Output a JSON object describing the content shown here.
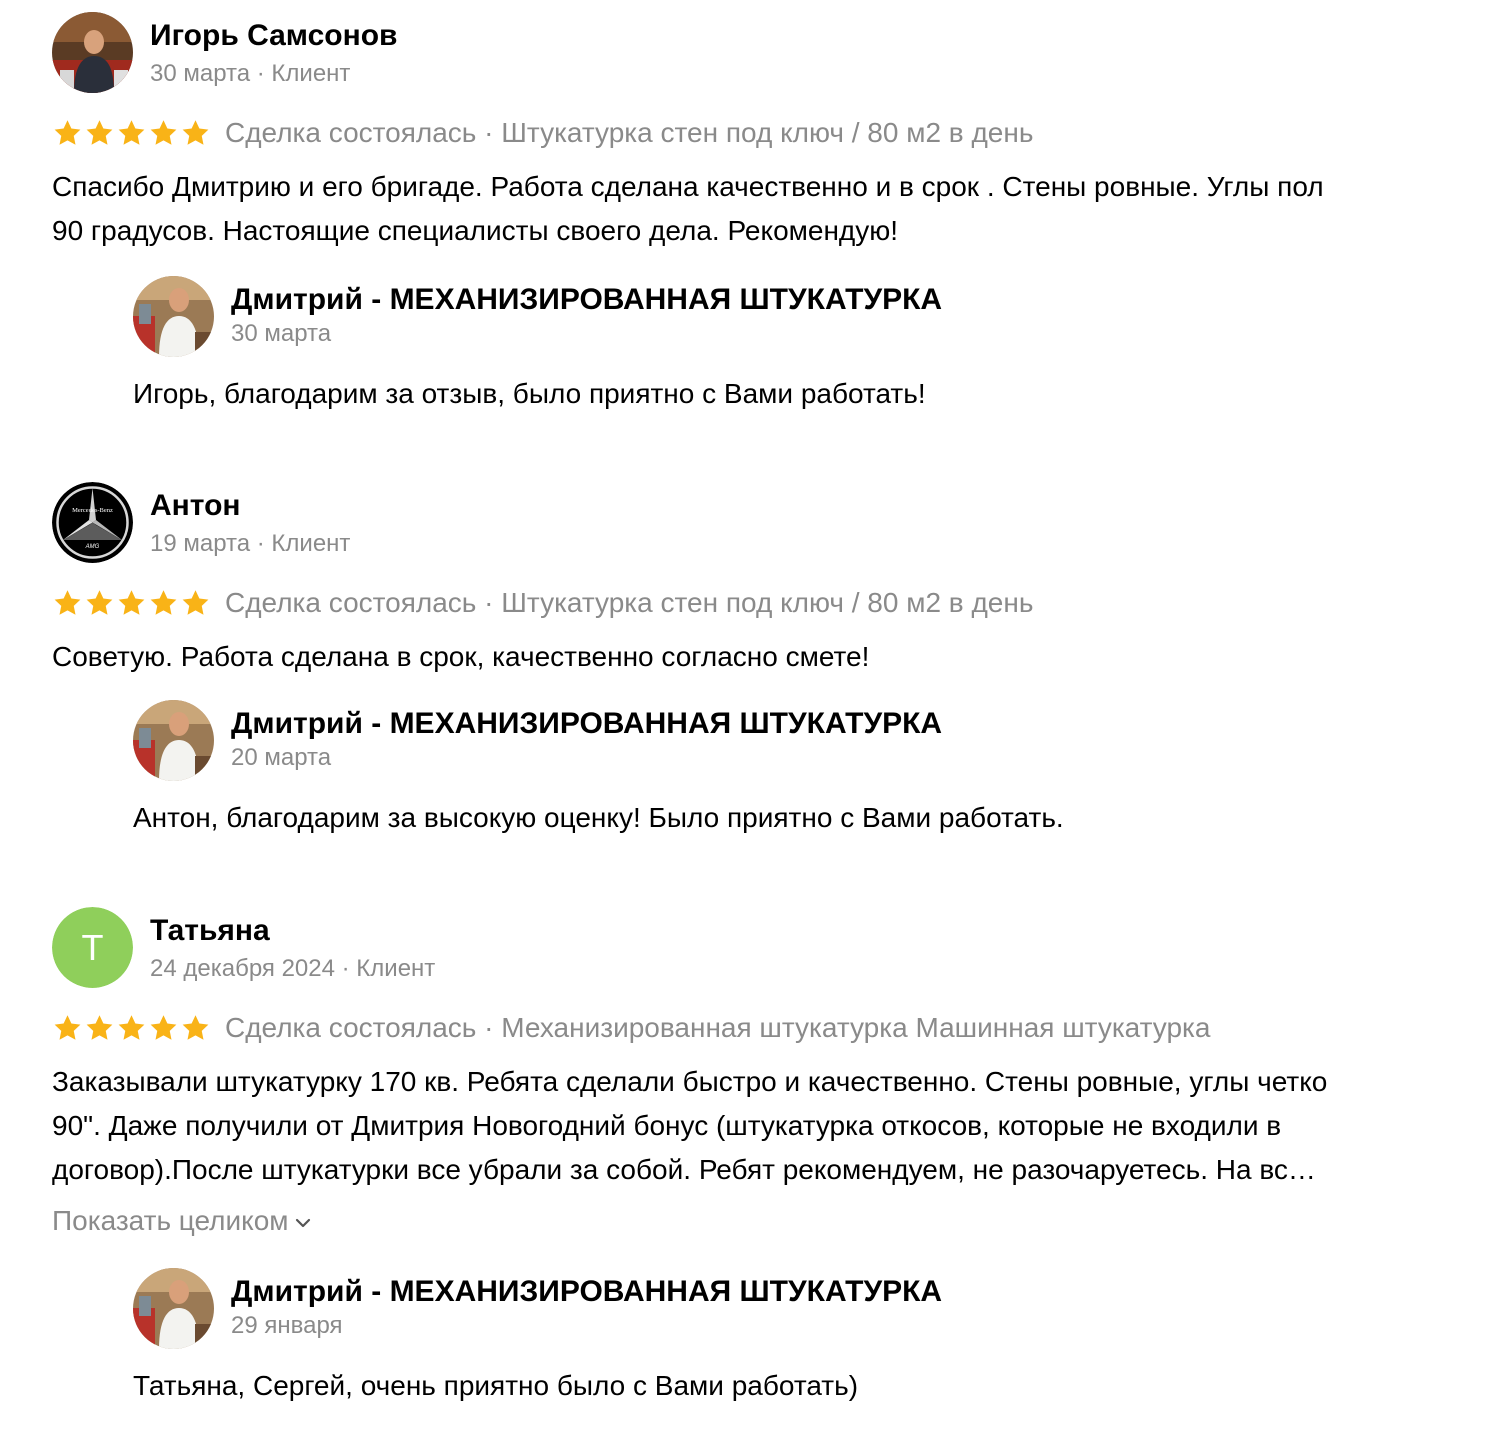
{
  "colors": {
    "star": "#f9b317",
    "muted": "#8a8a8a",
    "avatar_green": "#8fcf5b"
  },
  "reviews": [
    {
      "author": "Игорь Самсонов",
      "meta": "30 марта · Клиент",
      "avatar_icon": "person-photo",
      "rating": 5,
      "deal": "Сделка состоялась · Штукатурка стен под ключ / 80 м2 в день",
      "text": "Спасибо Дмитрию и его бригаде. Работа сделана качественно и в срок . Стены ровные. Углы пол\n90 градусов. Настоящие специалисты своего дела. Рекомендую!",
      "reply": {
        "author": "Дмитрий - МЕХАНИЗИРОВАННАЯ ШТУКАТУРКА",
        "date": "30 марта",
        "text": "Игорь, благодарим за отзыв, было приятно с Вами работать!"
      }
    },
    {
      "author": "Антон",
      "meta": "19 марта · Клиент",
      "avatar_icon": "mercedes-logo",
      "avatar_logo_text": "Mercedes-Benz",
      "avatar_logo_sub": "AMG",
      "rating": 5,
      "deal": "Сделка состоялась · Штукатурка стен под ключ / 80 м2 в день",
      "text": "Советую. Работа сделана в срок, качественно согласно смете!",
      "reply": {
        "author": "Дмитрий - МЕХАНИЗИРОВАННАЯ ШТУКАТУРКА",
        "date": "20 марта",
        "text": "Антон, благодарим за высокую оценку! Было приятно с Вами работать."
      }
    },
    {
      "author": "Татьяна",
      "meta": "24 декабря 2024 · Клиент",
      "avatar_letter": "Т",
      "rating": 5,
      "deal": "Сделка состоялась · Механизированная штукатурка Машинная штукатурка",
      "text": "Заказывали штукатурку 170 кв. Ребята сделали быстро и качественно. Стены ровные, углы четко\n90\". Даже получили от Дмитрия Новогодний бонус (штукатурка откосов, которые не входили в\nдоговор).После штукатурки все убрали за собой. Ребят рекомендуем, не разочаруетесь. На вс…",
      "show_more": "Показать целиком",
      "reply": {
        "author": "Дмитрий - МЕХАНИЗИРОВАННАЯ ШТУКАТУРКА",
        "date": "29 января",
        "text": "Татьяна, Сергей, очень приятно было с Вами работать)"
      }
    }
  ]
}
